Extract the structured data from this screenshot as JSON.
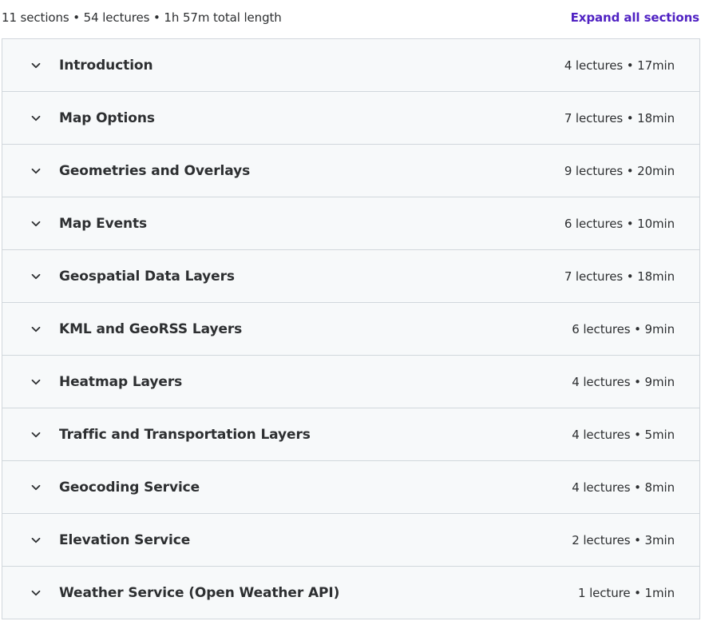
{
  "summary": {
    "text": "11 sections • 54 lectures • 1h 57m total length",
    "expand_label": "Expand all sections"
  },
  "icons": {
    "chevron": "chevron-down-icon"
  },
  "colors": {
    "link": "#5022c3",
    "row_background": "#f7f9fa",
    "border": "#d1d7dc",
    "text": "#2d2f31"
  },
  "sections": [
    {
      "title": "Introduction",
      "meta": "4 lectures • 17min"
    },
    {
      "title": "Map Options",
      "meta": "7 lectures • 18min"
    },
    {
      "title": "Geometries and Overlays",
      "meta": "9 lectures • 20min"
    },
    {
      "title": "Map Events",
      "meta": "6 lectures • 10min"
    },
    {
      "title": "Geospatial Data Layers",
      "meta": "7 lectures • 18min"
    },
    {
      "title": "KML and GeoRSS Layers",
      "meta": "6 lectures • 9min"
    },
    {
      "title": "Heatmap Layers",
      "meta": "4 lectures • 9min"
    },
    {
      "title": "Traffic and Transportation Layers",
      "meta": "4 lectures • 5min"
    },
    {
      "title": "Geocoding Service",
      "meta": "4 lectures • 8min"
    },
    {
      "title": "Elevation Service",
      "meta": "2 lectures • 3min"
    },
    {
      "title": "Weather Service (Open Weather API)",
      "meta": "1 lecture • 1min"
    }
  ]
}
